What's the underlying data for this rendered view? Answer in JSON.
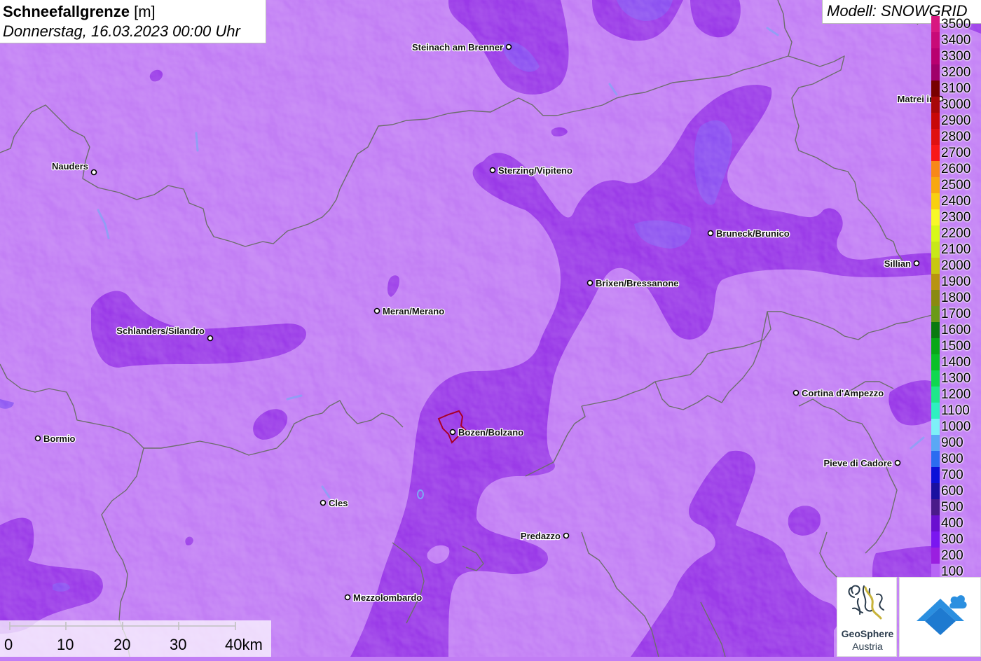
{
  "title": {
    "bold": "Schneefallgrenze",
    "unit": "[m]",
    "datetime": "Donnerstag, 16.03.2023 00:00 Uhr"
  },
  "model": "Modell: SNOWGRID",
  "colors": {
    "base": "#c27ef5",
    "dark": "#9a33e6",
    "darker": "#8c2ee0",
    "blue_accent": "#7d4ff7",
    "border": "#6d6d6d",
    "bozen_outline": "#a8002a"
  },
  "legend": [
    {
      "label": "100",
      "color": "#b765f5"
    },
    {
      "label": "200",
      "color": "#9a1fe0"
    },
    {
      "label": "300",
      "color": "#7a16f0"
    },
    {
      "label": "400",
      "color": "#6a0fd0"
    },
    {
      "label": "500",
      "color": "#4a1a8a"
    },
    {
      "label": "600",
      "color": "#1a10a0"
    },
    {
      "label": "700",
      "color": "#0b10d8"
    },
    {
      "label": "800",
      "color": "#2b6cf0"
    },
    {
      "label": "900",
      "color": "#5aa8f5"
    },
    {
      "label": "1000",
      "color": "#7ef0f8"
    },
    {
      "label": "1100",
      "color": "#2ff0c0"
    },
    {
      "label": "1200",
      "color": "#1ee88a"
    },
    {
      "label": "1300",
      "color": "#10d850"
    },
    {
      "label": "1400",
      "color": "#0ac028"
    },
    {
      "label": "1500",
      "color": "#08a818"
    },
    {
      "label": "1600",
      "color": "#0a7a10"
    },
    {
      "label": "1700",
      "color": "#6a9a18"
    },
    {
      "label": "1800",
      "color": "#8a8a10"
    },
    {
      "label": "1900",
      "color": "#b89410"
    },
    {
      "label": "2000",
      "color": "#c8c810"
    },
    {
      "label": "2100",
      "color": "#c8e818"
    },
    {
      "label": "2200",
      "color": "#d8f818"
    },
    {
      "label": "2300",
      "color": "#f8f828"
    },
    {
      "label": "2400",
      "color": "#f8d010"
    },
    {
      "label": "2500",
      "color": "#f8a810"
    },
    {
      "label": "2600",
      "color": "#f88818"
    },
    {
      "label": "2700",
      "color": "#f81818"
    },
    {
      "label": "2800",
      "color": "#e01010"
    },
    {
      "label": "2900",
      "color": "#c80808"
    },
    {
      "label": "3000",
      "color": "#a80808"
    },
    {
      "label": "3100",
      "color": "#780000"
    },
    {
      "label": "3200",
      "color": "#a0006a"
    },
    {
      "label": "3300",
      "color": "#b80070"
    },
    {
      "label": "3400",
      "color": "#c80a78"
    },
    {
      "label": "3500",
      "color": "#d81880"
    }
  ],
  "cities": [
    {
      "name": "Steinach am Brenner",
      "side": "left"
    },
    {
      "name": "Matrei in",
      "side": "left"
    },
    {
      "name": "Nauders",
      "side": "left"
    },
    {
      "name": "Sterzing/Vipiteno",
      "side": "right"
    },
    {
      "name": "Bruneck/Brunico",
      "side": "right"
    },
    {
      "name": "Sillian",
      "side": "left"
    },
    {
      "name": "Brixen/Bressanone",
      "side": "right"
    },
    {
      "name": "Meran/Merano",
      "side": "right"
    },
    {
      "name": "Schlanders/Silandro",
      "side": "left"
    },
    {
      "name": "Cortina d'Ampezzo",
      "side": "right"
    },
    {
      "name": "Bormio",
      "side": "right"
    },
    {
      "name": "Bozen/Bolzano",
      "side": "right"
    },
    {
      "name": "Pieve di Cadore",
      "side": "left"
    },
    {
      "name": "Cles",
      "side": "right"
    },
    {
      "name": "Predazzo",
      "side": "left"
    },
    {
      "name": "Mezzolombardo",
      "side": "right"
    }
  ],
  "scale": {
    "ticks": [
      "0",
      "10",
      "20",
      "30",
      "40km"
    ]
  },
  "logos": {
    "geosphere_name": "GeoSphere",
    "geosphere_sub": "Austria",
    "house_icon": "house-snow-icon"
  }
}
